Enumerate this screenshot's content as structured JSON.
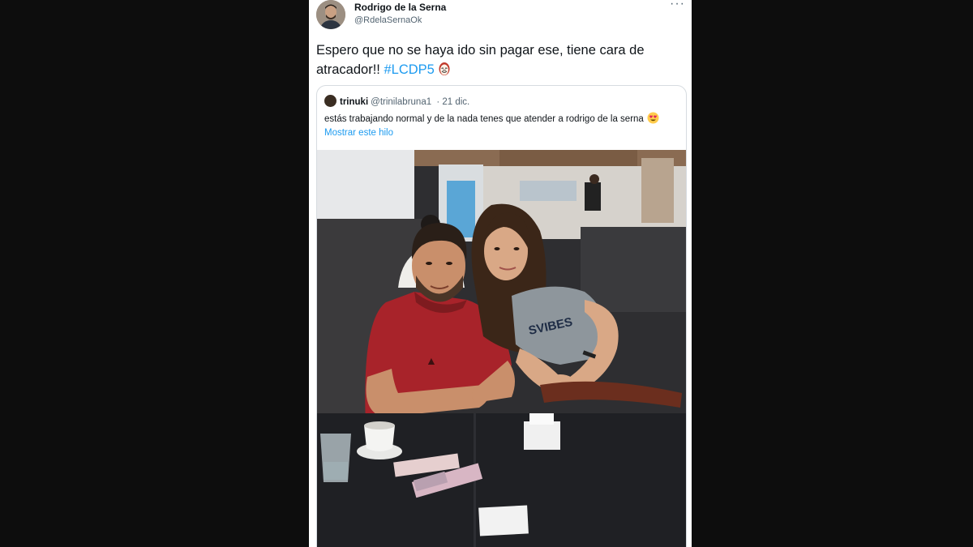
{
  "tweet": {
    "author_name": "Rodrigo de la Serna",
    "author_handle": "@RdelaSernaOk",
    "more_label": "···",
    "text": "Espero que no se haya ido sin pagar ese, tiene cara de atracador!! ",
    "hashtag": "#LCDP5",
    "emoji": "money-heist-mask-icon"
  },
  "quoted": {
    "author_name": "trinuki",
    "author_handle": "@trinilabruna1",
    "date": "· 21 dic.",
    "text": "estás trabajando normal y de la nada tenes que atender a rodrigo de la serna",
    "emoji": "heart-eyes-icon",
    "thread_link": "Mostrar este hilo",
    "photo_description_icon": "cafe-photo"
  },
  "photo_shirt_text": "SVIBES",
  "colors": {
    "background": "#0d0d0d",
    "card": "#ffffff",
    "link": "#1d9bf0",
    "text": "#0f1419",
    "secondary": "#536471"
  }
}
